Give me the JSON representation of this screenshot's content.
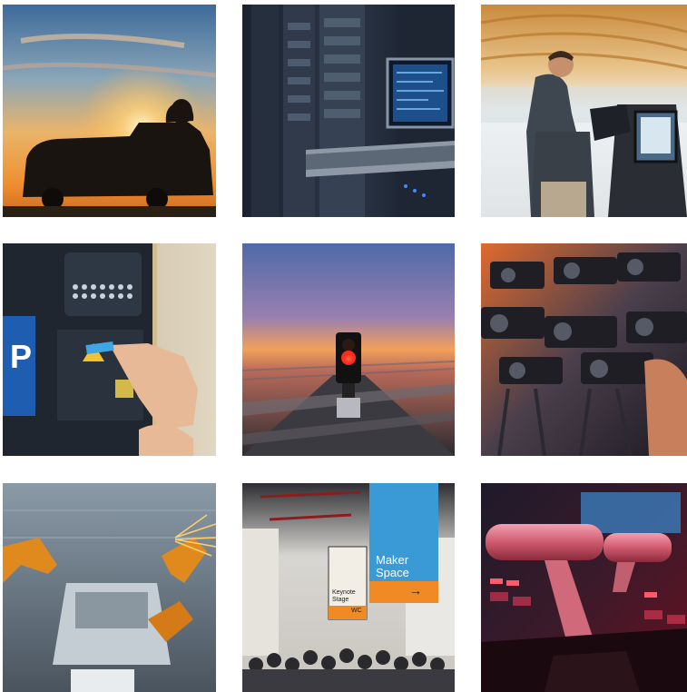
{
  "tiles": [
    {
      "id": "van-sunset",
      "scene": "satellite broadcast van silhouette at sunset"
    },
    {
      "id": "server-racks",
      "scene": "data center server racks with monitor"
    },
    {
      "id": "airport-kiosk",
      "scene": "man using self-service kiosk in airport terminal"
    },
    {
      "id": "parking-meter",
      "scene": "hand inserting card into parking payment machine"
    },
    {
      "id": "railway-signal",
      "scene": "red railway signal light on tracks at dusk"
    },
    {
      "id": "press-cameras",
      "scene": "crowd of press video cameras"
    },
    {
      "id": "robot-assembly",
      "scene": "robotic car assembly line with welding sparks"
    },
    {
      "id": "expo-hall",
      "scene": "crowded exhibition hall with signage"
    },
    {
      "id": "broadcast-console",
      "scene": "broadcast video switcher console lever"
    }
  ],
  "expo": {
    "maker_line1": "Maker",
    "maker_line2": "Space",
    "keynote_line1": "Keynote",
    "keynote_line2": "Stage",
    "wc_label": "WC",
    "arrow": "→"
  },
  "parking": {
    "sign_letter": "P"
  },
  "colors": {
    "background": "#ffffff",
    "expo_blue": "#3a9ad6",
    "expo_orange": "#f08a24",
    "signal_red": "#ff2a1a",
    "sunset_orange": "#f5a23a"
  }
}
